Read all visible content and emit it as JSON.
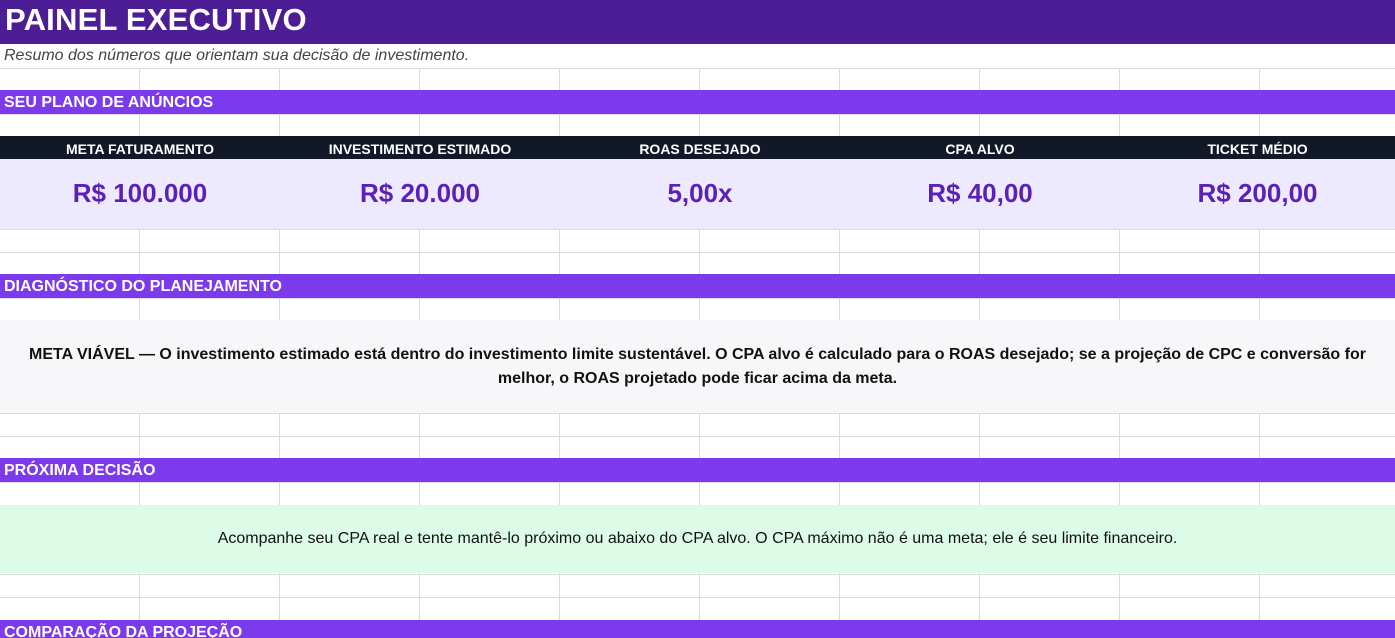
{
  "header": {
    "title": "PAINEL EXECUTIVO",
    "subtitle": "Resumo dos números que orientam sua decisão de investimento."
  },
  "sections": {
    "plan": "SEU PLANO DE ANÚNCIOS",
    "diagnosis": "DIAGNÓSTICO DO PLANEJAMENTO",
    "next_decision": "PRÓXIMA DECISÃO",
    "comparison": "COMPARAÇÃO DA PROJEÇÃO"
  },
  "kpis": [
    {
      "label": "META FATURAMENTO",
      "value": "R$ 100.000"
    },
    {
      "label": "INVESTIMENTO ESTIMADO",
      "value": "R$ 20.000"
    },
    {
      "label": "ROAS DESEJADO",
      "value": "5,00x"
    },
    {
      "label": "CPA ALVO",
      "value": "R$ 40,00"
    },
    {
      "label": "TICKET MÉDIO",
      "value": "R$ 200,00"
    }
  ],
  "diagnosis_text": "META VIÁVEL — O investimento estimado está dentro do investimento limite sustentável. O CPA alvo é calculado para o ROAS desejado; se a projeção de CPC e conversão for melhor, o ROAS projetado pode ficar acima da meta.",
  "next_decision_text": "Acompanhe seu CPA real e tente mantê-lo próximo ou abaixo do CPA alvo. O CPA máximo não é uma meta; ele é seu limite financeiro.",
  "colors": {
    "title_bg": "#4c1d95",
    "section_bg": "#7c3aed",
    "kpi_header_bg": "#111827",
    "kpi_value_bg": "#ede9fe",
    "kpi_value_text": "#5b21b6",
    "diagnosis_bg": "#f7f7f9",
    "next_decision_bg": "#dcfce7"
  }
}
